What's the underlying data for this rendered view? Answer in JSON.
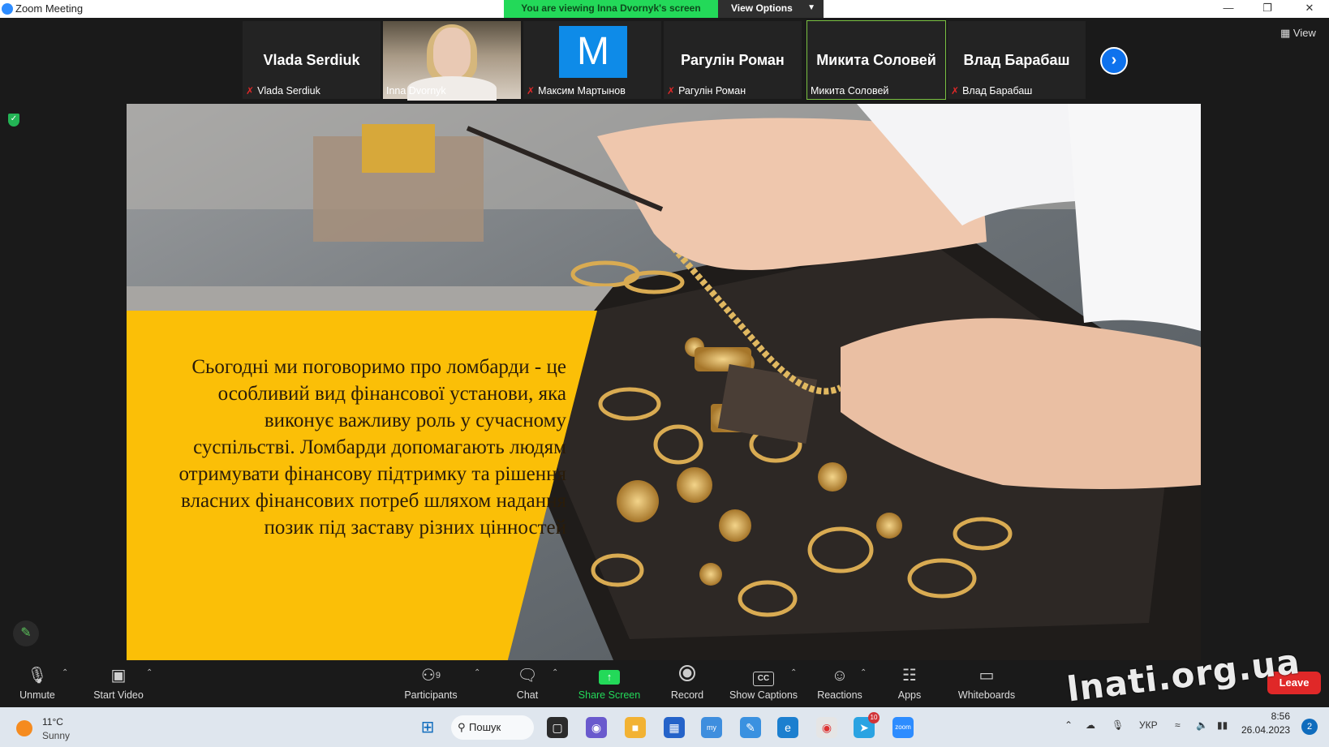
{
  "window": {
    "title": "Zoom Meeting"
  },
  "banner": {
    "viewing": "You are viewing Inna Dvornyk's screen",
    "view_options": "View Options"
  },
  "participants": [
    {
      "big_name": "Vlada Serdiuk",
      "name": "Vlada Serdiuk",
      "muted": true
    },
    {
      "big_name": "",
      "name": "Inna Dvornyk",
      "muted": false
    },
    {
      "avatar_letter": "M",
      "name": "Максим Мартынов",
      "muted": true
    },
    {
      "big_name": "Рагулін Роман",
      "name": "Рагулін Роман",
      "muted": true
    },
    {
      "big_name": "Микита Соловей",
      "name": "Микита Соловей",
      "muted": false
    },
    {
      "big_name": "Влад Барабаш",
      "name": "Влад Барабаш",
      "muted": true
    }
  ],
  "view_button": "View",
  "slide": {
    "text": "Сьогодні ми поговоримо про ломбарди - це особливий вид фінансової установи, яка виконує важливу роль у сучасному суспільстві. Ломбарди допомагають людям отримувати фінансову підтримку та рішення власних фінансових потреб шляхом надання позик під заставу різних цінностей"
  },
  "toolbar": {
    "unmute": "Unmute",
    "start_video": "Start Video",
    "participants": "Participants",
    "participants_count": "9",
    "chat": "Chat",
    "share_screen": "Share Screen",
    "record": "Record",
    "show_captions": "Show Captions",
    "reactions": "Reactions",
    "apps": "Apps",
    "whiteboards": "Whiteboards",
    "leave": "Leave"
  },
  "watermark": "lnati.org.ua",
  "taskbar": {
    "temperature": "11°C",
    "condition": "Sunny",
    "search": "Пошук",
    "language": "УКР",
    "time": "8:56",
    "date": "26.04.2023",
    "notification_count": "2",
    "telegram_badge": "10"
  },
  "colors": {
    "zoom_blue": "#0e72ed",
    "share_green": "#23d959",
    "slide_yellow": "#fbbf07",
    "leave_red": "#e02828"
  }
}
